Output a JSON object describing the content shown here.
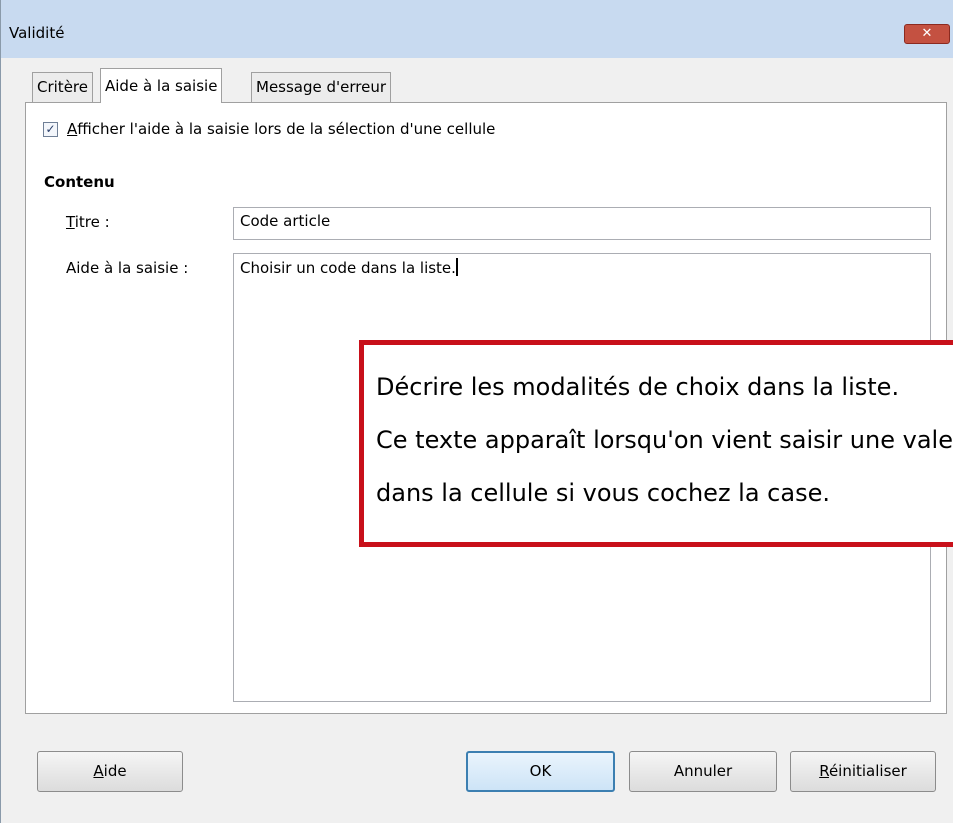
{
  "window": {
    "title": "Validité",
    "close_symbol": "✕"
  },
  "tabs": [
    {
      "label": "Critère"
    },
    {
      "label": "Aide à la saisie"
    },
    {
      "label": "Message d'erreur"
    }
  ],
  "panel": {
    "checkbox": {
      "label": "Afficher l'aide à la saisie lors de la sélection d'une cellule",
      "checked": true,
      "mark": "✓"
    },
    "section_title": "Contenu",
    "title_field": {
      "label": "Titre :",
      "value": "Code article"
    },
    "help_field": {
      "label": "Aide à la saisie :",
      "value": "Choisir un code dans la liste."
    }
  },
  "callout": {
    "lines": [
      "Décrire les modalités de choix dans la liste.",
      "Ce texte apparaît lorsqu'on vient saisir une valeur",
      "dans la cellule si vous cochez la case."
    ],
    "border_color": "#c8101a"
  },
  "buttons": {
    "help": "Aide",
    "ok": "OK",
    "cancel": "Annuler",
    "reset": "Réinitialiser"
  }
}
